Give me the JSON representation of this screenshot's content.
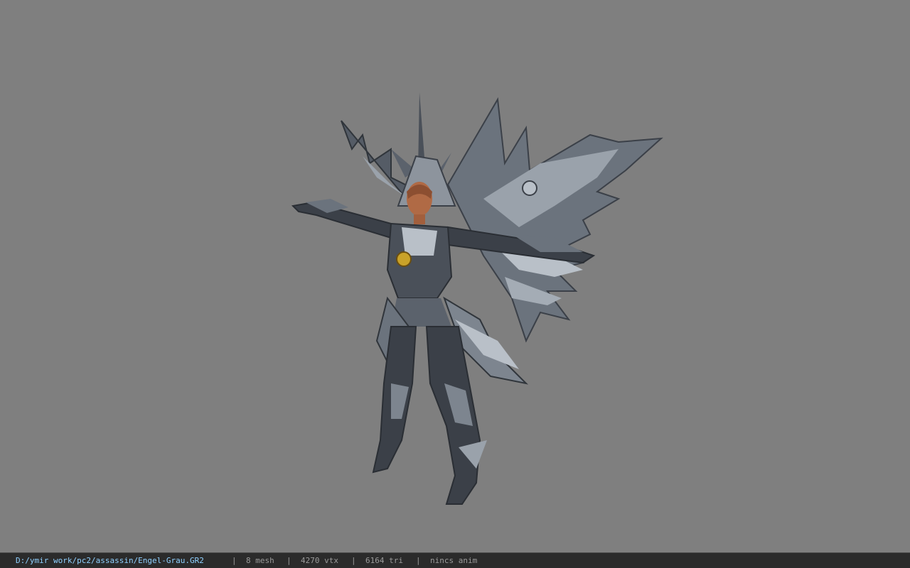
{
  "viewport": {
    "background_color": "#7f7f7f",
    "model_colors": {
      "armor_dark": "#3b4048",
      "armor_mid": "#6b737d",
      "armor_light": "#b9c0c8",
      "skin": "#b06a45",
      "emblem": "#c9a229"
    }
  },
  "statusbar": {
    "file_path": "D:/ymir work/pc2/assassin/Engel-Grau.GR2",
    "separator": "|",
    "mesh": "8 mesh",
    "vtx": "4270 vtx",
    "tri": "6164 tri",
    "anim": "nincs anim"
  }
}
